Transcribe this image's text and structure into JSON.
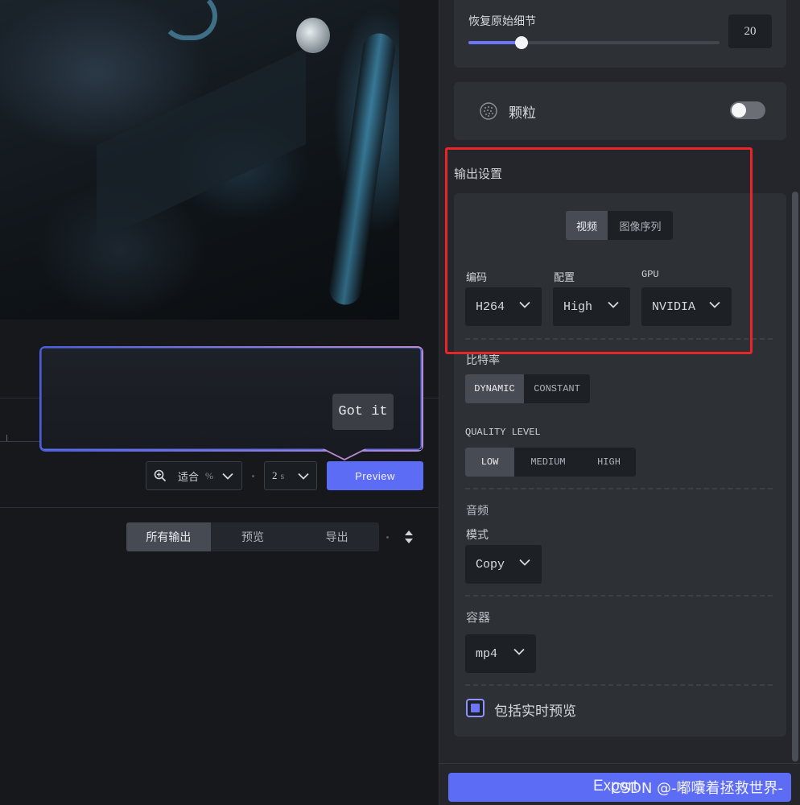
{
  "preview": {
    "tooltip_button_label": "Got it",
    "zoom_value": "适合",
    "zoom_unit": "%",
    "interval_value": "2",
    "interval_unit": "s",
    "preview_button_label": "Preview"
  },
  "output_list": {
    "tabs": [
      {
        "label": "所有输出",
        "active": true
      },
      {
        "label": "预览",
        "active": false
      },
      {
        "label": "导出",
        "active": false
      }
    ]
  },
  "effects": {
    "restore_detail_label": "恢复原始细节",
    "restore_detail_value": "20",
    "restore_detail_slider_fraction": 0.2,
    "grain_label": "颗粒",
    "grain_enabled": false
  },
  "output_settings": {
    "title": "输出设置",
    "format_tabs": [
      {
        "label": "视频",
        "active": true
      },
      {
        "label": "图像序列",
        "active": false
      }
    ],
    "codec_label": "编码",
    "codec_value": "H264",
    "profile_label": "配置",
    "profile_value": "High",
    "gpu_label": "GPU",
    "gpu_value": "NVIDIA",
    "bitrate_label": "比特率",
    "bitrate_options": [
      {
        "label": "DYNAMIC",
        "active": true
      },
      {
        "label": "CONSTANT",
        "active": false
      }
    ],
    "quality_label": "QUALITY LEVEL",
    "quality_options": [
      {
        "label": "LOW",
        "active": true
      },
      {
        "label": "MEDIUM",
        "active": false
      },
      {
        "label": "HIGH",
        "active": false
      }
    ],
    "audio_label": "音频",
    "audio_mode_label": "模式",
    "audio_mode_value": "Copy",
    "container_label": "容器",
    "container_value": "mp4",
    "include_live_preview_label": "包括实时预览",
    "include_live_preview_checked": true
  },
  "footer": {
    "export_label": "Export",
    "watermark": "CSDN @-嘟囔着拯救世界-"
  },
  "colors": {
    "accent": "#5c6cf4",
    "annotation": "#e8262a",
    "panel": "#24262b",
    "card": "#2d3035"
  }
}
